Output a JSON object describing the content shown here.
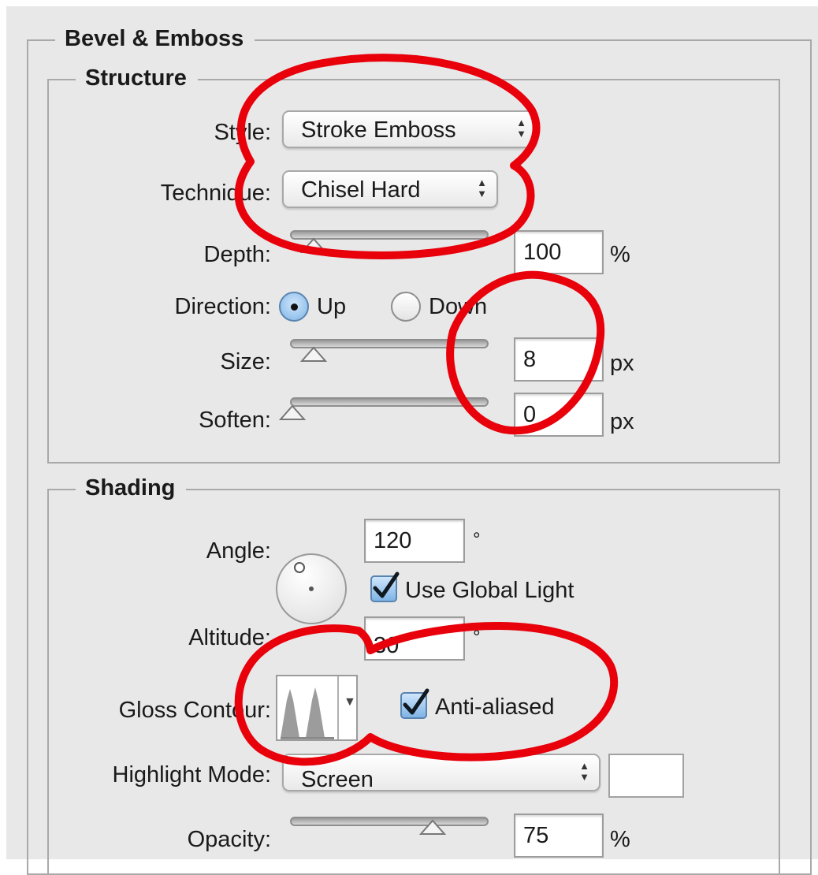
{
  "bevel_emboss": {
    "title": "Bevel & Emboss",
    "structure": {
      "title": "Structure",
      "style": {
        "label": "Style:",
        "value": "Stroke Emboss"
      },
      "technique": {
        "label": "Technique:",
        "value": "Chisel Hard"
      },
      "depth": {
        "label": "Depth:",
        "value": "100",
        "unit": "%",
        "slider_fraction": 0.06
      },
      "direction": {
        "label": "Direction:",
        "up_label": "Up",
        "down_label": "Down",
        "selected": "Up"
      },
      "size": {
        "label": "Size:",
        "value": "8",
        "unit": "px",
        "slider_fraction": 0.06
      },
      "soften": {
        "label": "Soften:",
        "value": "0",
        "unit": "px",
        "slider_fraction": 0.0
      }
    },
    "shading": {
      "title": "Shading",
      "angle": {
        "label": "Angle:",
        "value": "120",
        "unit": "°"
      },
      "use_global_light": {
        "label": "Use Global Light",
        "checked": true
      },
      "altitude": {
        "label": "Altitude:",
        "value": "30",
        "unit": "°"
      },
      "gloss_contour": {
        "label": "Gloss Contour:"
      },
      "anti_aliased": {
        "label": "Anti-aliased",
        "checked": true
      },
      "highlight_mode": {
        "label": "Highlight Mode:",
        "value": "Screen",
        "color": "#ffffff"
      },
      "opacity": {
        "label": "Opacity:",
        "value": "75",
        "unit": "%",
        "slider_fraction": 0.75
      }
    }
  },
  "colors": {
    "annotation": "#e8000b",
    "checkbox_accent": "#7eb4e6"
  },
  "icons": {
    "up_down_arrows": "up-down-arrows-icon",
    "check": "checkmark-icon",
    "contour": "contour-preview-icon"
  }
}
